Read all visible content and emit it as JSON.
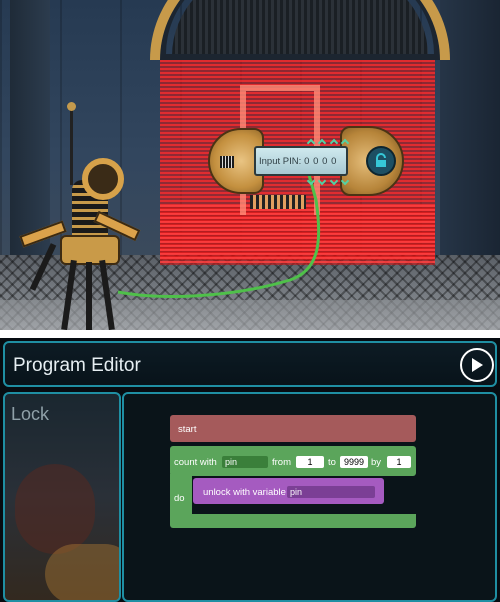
{
  "device": {
    "pin_label": "Input PIN:",
    "digits": [
      "0",
      "0",
      "0",
      "0"
    ]
  },
  "editor": {
    "title": "Program Editor",
    "panel_label": "Lock",
    "blocks": {
      "start_label": "start",
      "count_with_label": "count with",
      "count_var": "pin",
      "from_label": "from",
      "from_value": "1",
      "to_label": "to",
      "to_value": "9999",
      "by_label": "by",
      "by_value": "1",
      "do_label": "do",
      "unlock_label": "unlock with variable",
      "unlock_var": "pin"
    }
  },
  "colors": {
    "accent_border": "#1f8fa3",
    "start_block": "#a55a5b",
    "loop_block": "#5ba55b",
    "unlock_block": "#a55bc0",
    "laser": "#ff2828"
  }
}
